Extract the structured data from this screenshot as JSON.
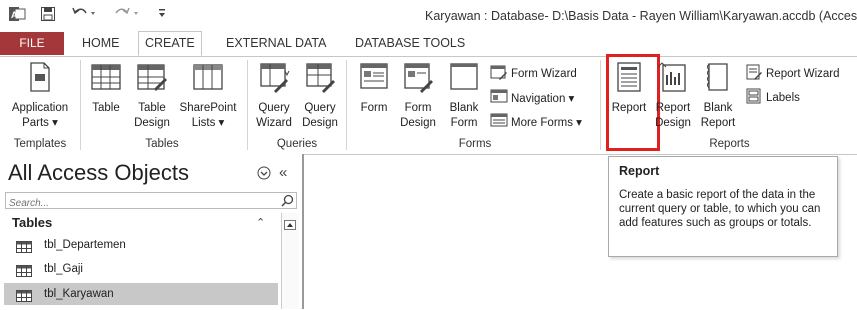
{
  "window": {
    "title": "Karyawan : Database- D:\\Basis Data - Rayen William\\Karyawan.accdb (Acces"
  },
  "quick_access": [
    "access-logo-icon",
    "save-icon",
    "undo-icon",
    "redo-icon",
    "customize-icon"
  ],
  "tabs": [
    {
      "label": "FILE"
    },
    {
      "label": "HOME"
    },
    {
      "label": "CREATE",
      "active": true
    },
    {
      "label": "EXTERNAL DATA"
    },
    {
      "label": "DATABASE TOOLS"
    }
  ],
  "ribbon": {
    "templates": {
      "group_label": "Templates",
      "application_parts_line1": "Application",
      "application_parts_line2": "Parts ▾"
    },
    "tables": {
      "group_label": "Tables",
      "table": "Table",
      "table_design_line1": "Table",
      "table_design_line2": "Design",
      "sharepoint_line1": "SharePoint",
      "sharepoint_line2": "Lists ▾"
    },
    "queries": {
      "group_label": "Queries",
      "wizard_line1": "Query",
      "wizard_line2": "Wizard",
      "design_line1": "Query",
      "design_line2": "Design"
    },
    "forms": {
      "group_label": "Forms",
      "form": "Form",
      "form_design_line1": "Form",
      "form_design_line2": "Design",
      "blank_form_line1": "Blank",
      "blank_form_line2": "Form",
      "form_wizard": "Form Wizard",
      "navigation": "Navigation ▾",
      "more_forms": "More Forms ▾"
    },
    "reports": {
      "group_label": "Reports",
      "report": "Report",
      "report_design_line1": "Report",
      "report_design_line2": "Design",
      "blank_report_line1": "Blank",
      "blank_report_line2": "Report",
      "report_wizard": "Report Wizard",
      "labels": "Labels"
    }
  },
  "nav_pane": {
    "title": "All Access Objects",
    "search_placeholder": "Search...",
    "section": "Tables",
    "items": [
      {
        "label": "tbl_Departemen",
        "selected": false
      },
      {
        "label": "tbl_Gaji",
        "selected": false
      },
      {
        "label": "tbl_Karyawan",
        "selected": true
      }
    ]
  },
  "tooltip": {
    "title": "Report",
    "text": "Create a basic report of the data in the current query or table, to which you can add features such as groups or totals."
  },
  "colors": {
    "file_tab": "#a4373a",
    "highlight": "#e02020",
    "selected_item": "#c8c8c8"
  }
}
